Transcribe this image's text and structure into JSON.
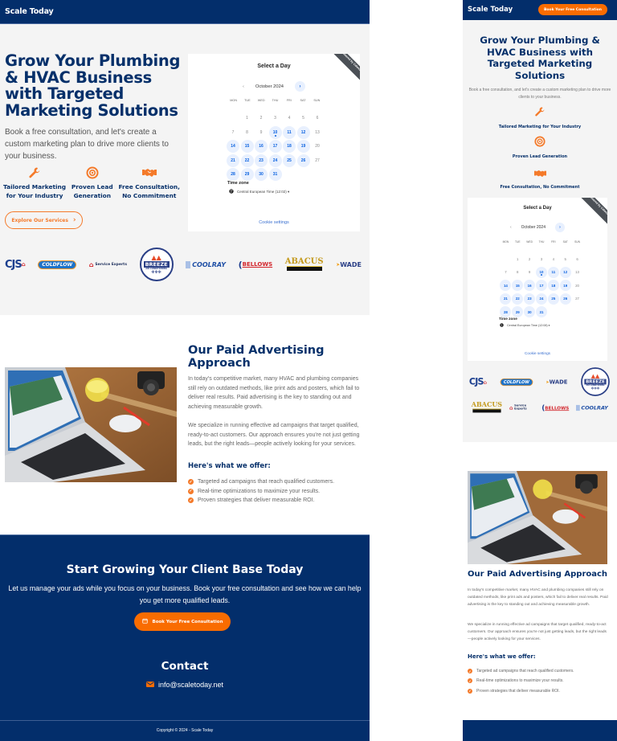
{
  "brand": {
    "name": "Scale Today",
    "primary_color": "#032e6b",
    "accent_color": "#f96c00",
    "calendar_accent": "#0a62e0"
  },
  "desktop": {
    "header": {
      "logo": "Scale Today"
    },
    "hero": {
      "title": "Grow Your Plumbing & HVAC Business with Targeted Marketing Solutions",
      "subtitle": "Book a free consultation, and let's create a custom marketing plan to drive more clients to your business.",
      "features": [
        {
          "icon": "wrench-icon",
          "label_line1": "Tailored Marketing",
          "label_line2": "for Your Industry"
        },
        {
          "icon": "target-icon",
          "label_line1": "Proven Lead",
          "label_line2": "Generation"
        },
        {
          "icon": "handshake-icon",
          "label_line1": "Free Consultation,",
          "label_line2": "No Commitment"
        }
      ],
      "explore_button": "Explore Our Services",
      "explore_chevron": "›"
    },
    "ads": {
      "title": "Our Paid Advertising Approach",
      "paragraph1": "In today's competitive market, many HVAC and plumbing companies still rely on outdated methods, like print ads and posters, which fail to deliver real results. Paid advertising is the key to standing out and achieving measurable growth.",
      "paragraph2": "We specialize in running effective ad campaigns that target qualified, ready-to-act customers. Our approach ensures you're not just getting leads, but the right leads—people actively looking for your services.",
      "offer_heading": "Here's what we offer:",
      "offers": [
        "Targeted ad campaigns that reach qualified customers.",
        "Real-time optimizations to maximize your results.",
        "Proven strategies that deliver measurable ROI."
      ]
    },
    "cta": {
      "title": "Start Growing Your Client Base Today",
      "text": "Let us manage your ads while you focus on your business. Book your free consultation and see how we can help you get more qualified leads.",
      "button": "Book Your Free Consultation"
    },
    "contact": {
      "title": "Contact",
      "email": "info@scaletoday.net"
    },
    "footer": {
      "copyright": "Copyright © 2024 - Scale Today"
    }
  },
  "calendar": {
    "title": "Select a Day",
    "ribbon": "Powered by Calendly",
    "month": "October 2024",
    "prev": "‹",
    "next": "›",
    "weekdays": [
      "MON",
      "TUE",
      "WED",
      "THU",
      "FRI",
      "SAT",
      "SUN"
    ],
    "first_weekday_offset": 1,
    "days_in_month": 31,
    "available_days": [
      10,
      11,
      12,
      14,
      15,
      16,
      17,
      18,
      19,
      21,
      22,
      23,
      24,
      25,
      26,
      28,
      29,
      30,
      31
    ],
    "today": 10,
    "timezone_label": "Time zone",
    "timezone_desktop": "Central European Time (12:02) ▾",
    "timezone_mobile": "Central European Time (12:08) ▾",
    "cookie_settings": "Cookie settings"
  },
  "logos": {
    "desktop_order": [
      "CJS Heating and Air",
      "Coldflow",
      "Service Experts",
      "Breeze Air Conditioning",
      "Coolray",
      "Bellows",
      "Abacus",
      "Wade"
    ],
    "mobile_row1": [
      "CJS Heating and Air",
      "Coldflow",
      "Wade",
      "Breeze Air Conditioning"
    ],
    "mobile_row2": [
      "Abacus",
      "Service Experts",
      "Bellows",
      "Coolray"
    ]
  },
  "mobile": {
    "header": {
      "logo": "Scale Today",
      "book_button": "Book Your Free Consultation"
    },
    "hero": {
      "title": "Grow Your Plumbing & HVAC Business with Targeted Marketing Solutions",
      "subtitle": "Book a free consultation, and let's create a custom marketing plan to drive more clients to your business.",
      "features": [
        {
          "icon": "wrench-icon",
          "label": "Tailored Marketing for Your Industry"
        },
        {
          "icon": "target-icon",
          "label": "Proven Lead Generation"
        },
        {
          "icon": "handshake-icon",
          "label": "Free Consultation, No Commitment"
        }
      ]
    }
  }
}
